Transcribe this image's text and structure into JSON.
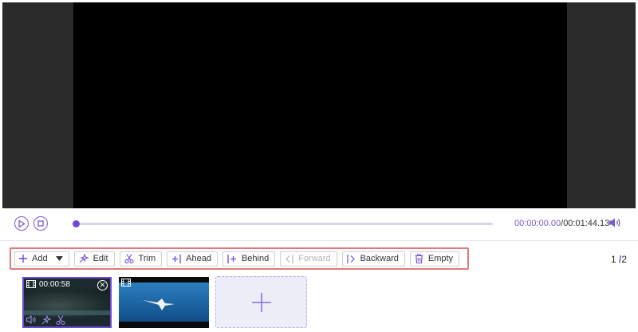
{
  "playback": {
    "current_time": "00:00:00.00",
    "separator": "/",
    "total_time": "00:01:44.13",
    "progress": 0.0
  },
  "toolbar": {
    "add_label": "Add",
    "edit_label": "Edit",
    "trim_label": "Trim",
    "ahead_label": "Ahead",
    "behind_label": "Behind",
    "forward_label": "Forward",
    "backward_label": "Backward",
    "empty_label": "Empty"
  },
  "pager": {
    "current": "1",
    "separator": "/",
    "total": "2"
  },
  "clips": [
    {
      "duration": "00:00:58",
      "selected": true
    },
    {
      "duration": "",
      "selected": false
    }
  ],
  "colors": {
    "accent": "#6e4bd6",
    "highlight_border": "#e07a7a",
    "preview_bg": "#2b2b2b"
  }
}
